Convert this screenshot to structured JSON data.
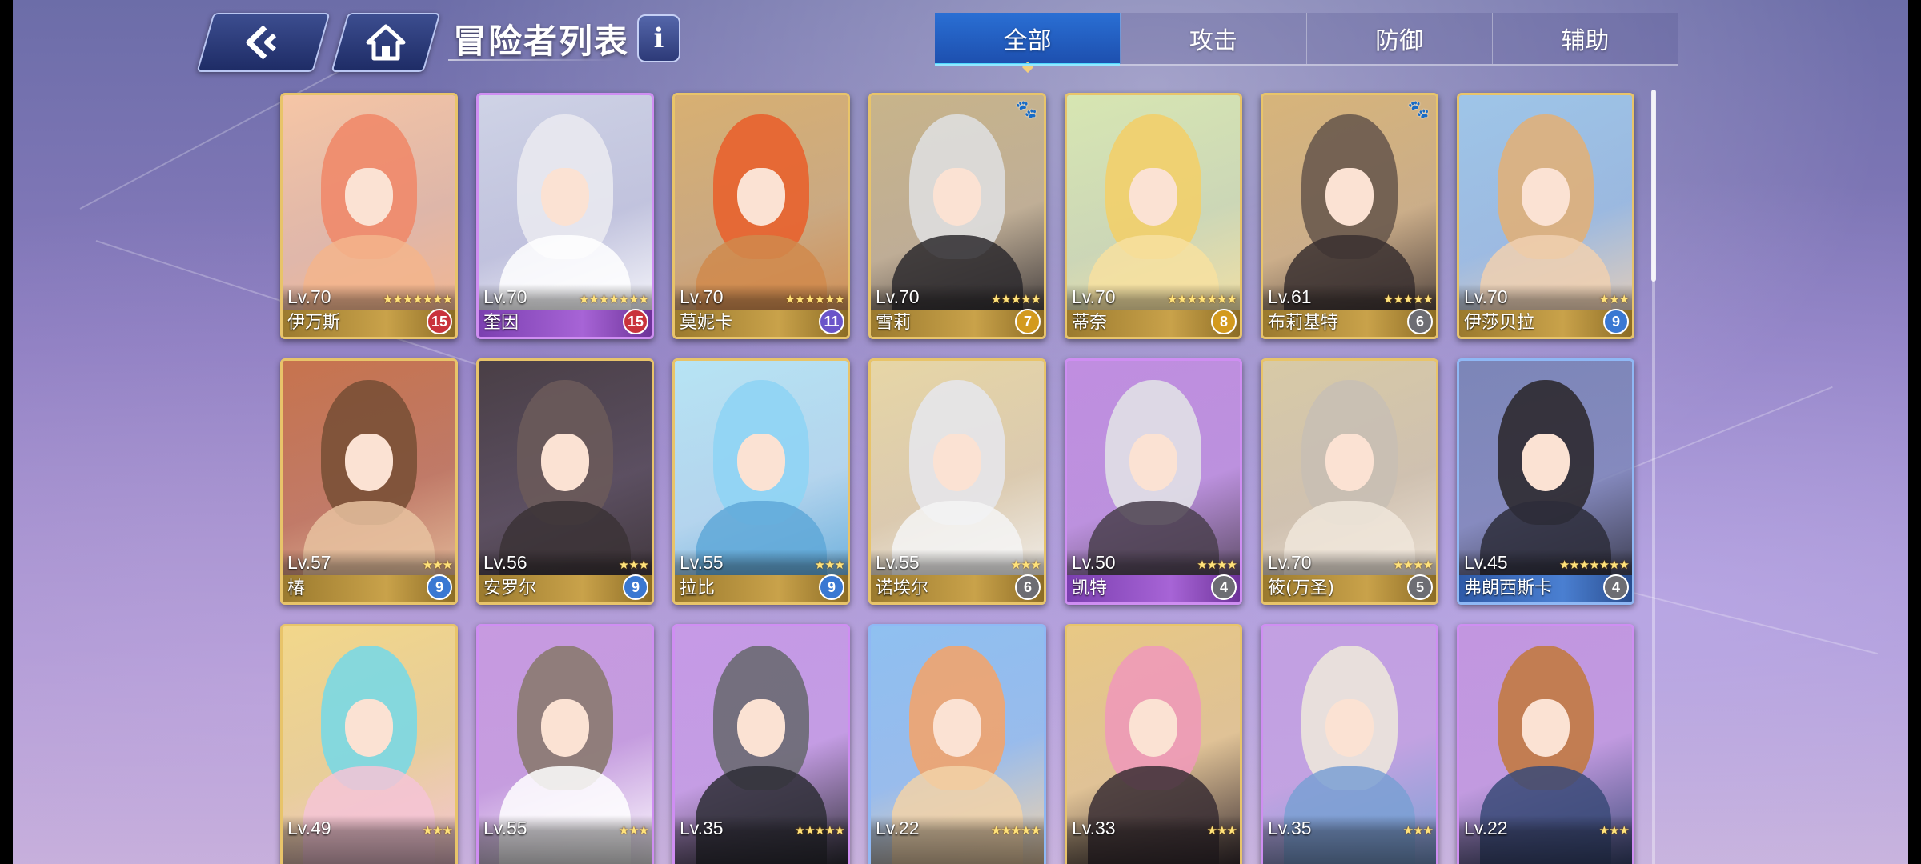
{
  "header": {
    "title": "冒险者列表",
    "back_icon": "back-arrow-icon",
    "home_icon": "home-icon",
    "info_label": "i"
  },
  "tabs": [
    {
      "label": "全部",
      "active": true
    },
    {
      "label": "攻击",
      "active": false
    },
    {
      "label": "防御",
      "active": false
    },
    {
      "label": "辅助",
      "active": false
    }
  ],
  "colors": {
    "tab_active": "#2a6fd4",
    "frame_gold": "#e8c46a",
    "frame_purple": "#cf8ef2",
    "frame_blue": "#8fb8f5",
    "badge_red": "#c9333b",
    "badge_purple": "#6a55c9",
    "badge_gold": "#d39a1e",
    "badge_gray": "#6d6d73",
    "badge_blue": "#3a78d2"
  },
  "adventurers": [
    {
      "level": "Lv.70",
      "stars": 7,
      "name": "伊万斯",
      "badge": "15",
      "badge_color": "#c9333b",
      "frame": "gold",
      "hair": "#f08a6a",
      "bg": "#f6c6a6",
      "outfit": "#f3b58c",
      "paw": false
    },
    {
      "level": "Lv.70",
      "stars": 7,
      "name": "奎因",
      "badge": "15",
      "badge_color": "#c9333b",
      "frame": "purple",
      "hair": "#e9e9f0",
      "bg": "#cfd3e6",
      "outfit": "#ffffff",
      "paw": false
    },
    {
      "level": "Lv.70",
      "stars": 6,
      "name": "莫妮卡",
      "badge": "11",
      "badge_color": "#6a55c9",
      "frame": "gold",
      "hair": "#e8622e",
      "bg": "#d8b072",
      "outfit": "#d08a4c",
      "paw": false
    },
    {
      "level": "Lv.70",
      "stars": 5,
      "name": "雪莉",
      "badge": "7",
      "badge_color": "#d39a1e",
      "frame": "gold",
      "hair": "#dedede",
      "bg": "#c8b48a",
      "outfit": "#2d2a2e",
      "paw": true
    },
    {
      "level": "Lv.70",
      "stars": 7,
      "name": "蒂奈",
      "badge": "8",
      "badge_color": "#d39a1e",
      "frame": "gold",
      "hair": "#f2cf6a",
      "bg": "#d7e6b2",
      "outfit": "#f7e0a0",
      "paw": false
    },
    {
      "level": "Lv.61",
      "stars": 5,
      "name": "布莉基特",
      "badge": "6",
      "badge_color": "#6d6d73",
      "frame": "gold",
      "hair": "#6a5a4e",
      "bg": "#d7b47a",
      "outfit": "#3a3030",
      "paw": true
    },
    {
      "level": "Lv.70",
      "stars": 3,
      "name": "伊莎贝拉",
      "badge": "9",
      "badge_color": "#3a78d2",
      "frame": "gold",
      "hair": "#e0b07a",
      "bg": "#9ec5e8",
      "outfit": "#f0d0b0",
      "paw": false
    },
    {
      "level": "Lv.57",
      "stars": 3,
      "name": "椿",
      "badge": "9",
      "badge_color": "#3a78d2",
      "frame": "gold",
      "hair": "#7a5036",
      "bg": "#c7744e",
      "outfit": "#e7c2a0",
      "paw": false
    },
    {
      "level": "Lv.56",
      "stars": 3,
      "name": "安罗尔",
      "badge": "9",
      "badge_color": "#3a78d2",
      "frame": "gold",
      "hair": "#6a5a5a",
      "bg": "#4a3f46",
      "outfit": "#3b3236",
      "paw": false
    },
    {
      "level": "Lv.55",
      "stars": 3,
      "name": "拉比",
      "badge": "9",
      "badge_color": "#3a78d2",
      "frame": "gold",
      "hair": "#8fd4f4",
      "bg": "#b7e4f4",
      "outfit": "#5fa8d8",
      "paw": false
    },
    {
      "level": "Lv.55",
      "stars": 3,
      "name": "诺埃尔",
      "badge": "6",
      "badge_color": "#6d6d73",
      "frame": "gold",
      "hair": "#e6e6ea",
      "bg": "#e7d6a6",
      "outfit": "#f4f4f4",
      "paw": false
    },
    {
      "level": "Lv.50",
      "stars": 4,
      "name": "凯特",
      "badge": "4",
      "badge_color": "#6d6d73",
      "frame": "purple",
      "hair": "#e0e0e6",
      "bg": "#c08ee0",
      "outfit": "#4a3f4e",
      "paw": false
    },
    {
      "level": "Lv.70",
      "stars": 4,
      "name": "筱(万圣)",
      "badge": "5",
      "badge_color": "#6d6d73",
      "frame": "gold",
      "hair": "#c8bfb4",
      "bg": "#d8caa6",
      "outfit": "#f0e6da",
      "paw": false
    },
    {
      "level": "Lv.45",
      "stars": 7,
      "name": "弗朗西斯卡",
      "badge": "4",
      "badge_color": "#6d6d73",
      "frame": "blue",
      "hair": "#2e2a30",
      "bg": "#7c86b8",
      "outfit": "#2d2d3a",
      "paw": false
    },
    {
      "level": "Lv.49",
      "stars": 3,
      "name": "",
      "badge": "",
      "badge_color": "",
      "frame": "gold",
      "hair": "#7ad8e4",
      "bg": "#f2d78a",
      "outfit": "#f4c4d6",
      "paw": false
    },
    {
      "level": "Lv.55",
      "stars": 3,
      "name": "",
      "badge": "",
      "badge_color": "",
      "frame": "purple",
      "hair": "#8a7a70",
      "bg": "#c79ae0",
      "outfit": "#ffffff",
      "paw": false
    },
    {
      "level": "Lv.35",
      "stars": 5,
      "name": "",
      "badge": "",
      "badge_color": "",
      "frame": "purple",
      "hair": "#6a6a72",
      "bg": "#c69ae6",
      "outfit": "#2e2e36",
      "paw": false
    },
    {
      "level": "Lv.22",
      "stars": 5,
      "name": "",
      "badge": "",
      "badge_color": "",
      "frame": "blue",
      "hair": "#f1a46e",
      "bg": "#8fc0f0",
      "outfit": "#f2d2a8",
      "paw": false
    },
    {
      "level": "Lv.33",
      "stars": 3,
      "name": "",
      "badge": "",
      "badge_color": "",
      "frame": "gold",
      "hair": "#ee9ab8",
      "bg": "#e8c884",
      "outfit": "#3a2e34",
      "paw": false
    },
    {
      "level": "Lv.35",
      "stars": 3,
      "name": "",
      "badge": "",
      "badge_color": "",
      "frame": "purple",
      "hair": "#ece6dc",
      "bg": "#c3a0e2",
      "outfit": "#7aa0d4",
      "paw": false
    },
    {
      "level": "Lv.22",
      "stars": 3,
      "name": "",
      "badge": "",
      "badge_color": "",
      "frame": "purple",
      "hair": "#c27a42",
      "bg": "#c296e0",
      "outfit": "#3a4a78",
      "paw": false
    }
  ]
}
